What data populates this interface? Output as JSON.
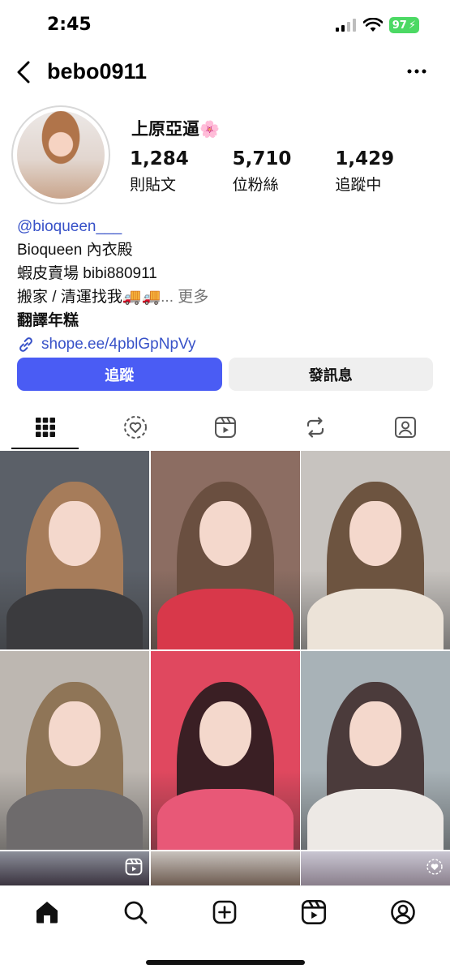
{
  "status_bar": {
    "time": "2:45",
    "battery": "97"
  },
  "header": {
    "username": "bebo0911"
  },
  "profile": {
    "display_name": "上原亞逼",
    "name_emoji": "🌸",
    "stats": [
      {
        "value": "1,284",
        "label": "則貼文"
      },
      {
        "value": "5,710",
        "label": "位粉絲"
      },
      {
        "value": "1,429",
        "label": "追蹤中"
      }
    ]
  },
  "bio": {
    "handle": "@bioqueen___",
    "line1": "Bioqueen 內衣殿",
    "line2": "蝦皮賣場 bibi880911",
    "line3": "搬家 / 清運找我🚚🚚",
    "more": "... 更多",
    "line4": "翻譯年糕",
    "link": "shope.ee/4pblGpNpVy"
  },
  "buttons": {
    "follow": "追蹤",
    "message": "發訊息"
  },
  "tabs": [
    {
      "icon": "grid-icon",
      "active": true
    },
    {
      "icon": "reels-heart-icon",
      "active": false
    },
    {
      "icon": "reels-icon",
      "active": false
    },
    {
      "icon": "repost-icon",
      "active": false
    },
    {
      "icon": "tagged-icon",
      "active": false
    }
  ],
  "posts": [
    {
      "bg": "#5b6068",
      "hair": "#a67c5a",
      "top": "#3b3b3e"
    },
    {
      "bg": "#8c6d62",
      "hair": "#6a4f40",
      "top": "#d8384a"
    },
    {
      "bg": "#c7c3bf",
      "hair": "#6d5440",
      "top": "#ece3d8"
    },
    {
      "bg": "#bdb7b1",
      "hair": "#8f7557",
      "top": "#6e6b6c"
    },
    {
      "bg": "#e0485f",
      "hair": "#3a1f24",
      "top": "#e85877"
    },
    {
      "bg": "#a8b2b7",
      "hair": "#4b3b3b",
      "top": "#ede9e5"
    }
  ],
  "colors": {
    "accent": "#4a5cf4",
    "link": "#3852c8",
    "muted": "#737373"
  },
  "bottom_nav": [
    "home-icon",
    "search-icon",
    "create-icon",
    "reels-icon",
    "profile-icon"
  ]
}
